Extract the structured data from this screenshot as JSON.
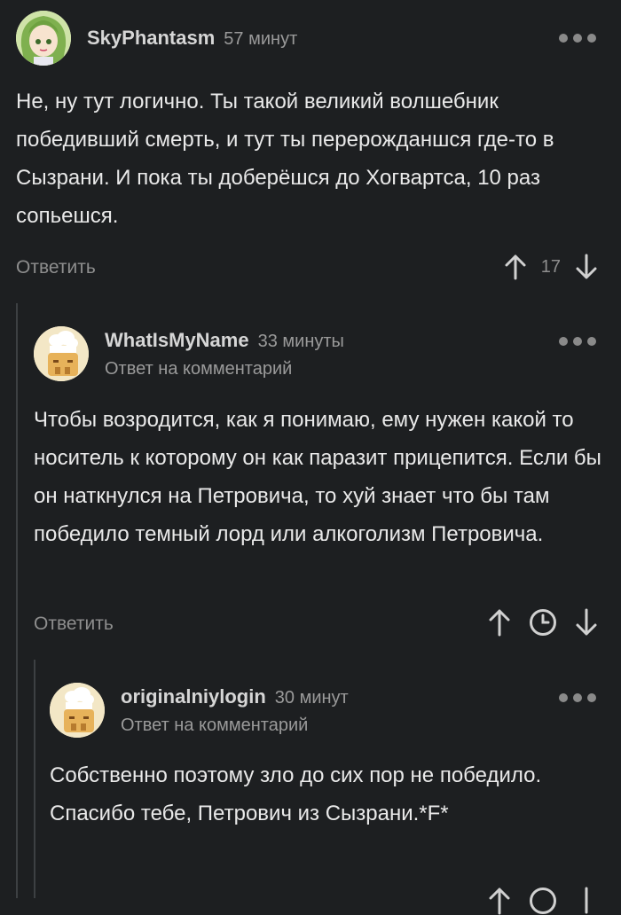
{
  "comments": [
    {
      "author": "SkyPhantasm",
      "time": "57 минут",
      "text": "Не, ну тут логично. Ты такой великий волшебник победивший смерть, и тут ты перерожданшся где-то в Сызрани. И пока ты доберёшся до Хогвартса, 10 раз сопьешся.",
      "reply_label": "Ответить",
      "rating": "17",
      "avatar_icon": "anime-avatar-icon"
    },
    {
      "author": "WhatIsMyName",
      "time": "33 минуты",
      "reply_to": "Ответ на комментарий",
      "text": "Чтобы возродится, как я понимаю, ему нужен какой то носитель к которому он как паразит прицепится. Если бы он наткнулся на Петровича, то хуй знает что бы там победило темный лорд или алкоголизм Петровича.",
      "reply_label": "Ответить",
      "avatar_icon": "chef-avatar-icon"
    },
    {
      "author": "originalniylogin",
      "time": "30 минут",
      "reply_to": "Ответ на комментарий",
      "text": "Собственно поэтому зло до сих пор не победило. Спасибо тебе, Петрович из Сызрани.*F*",
      "avatar_icon": "chef-avatar-icon"
    }
  ],
  "colors": {
    "background": "#1d1f21",
    "text": "#e9e9e9",
    "muted": "#8e8e8e"
  }
}
